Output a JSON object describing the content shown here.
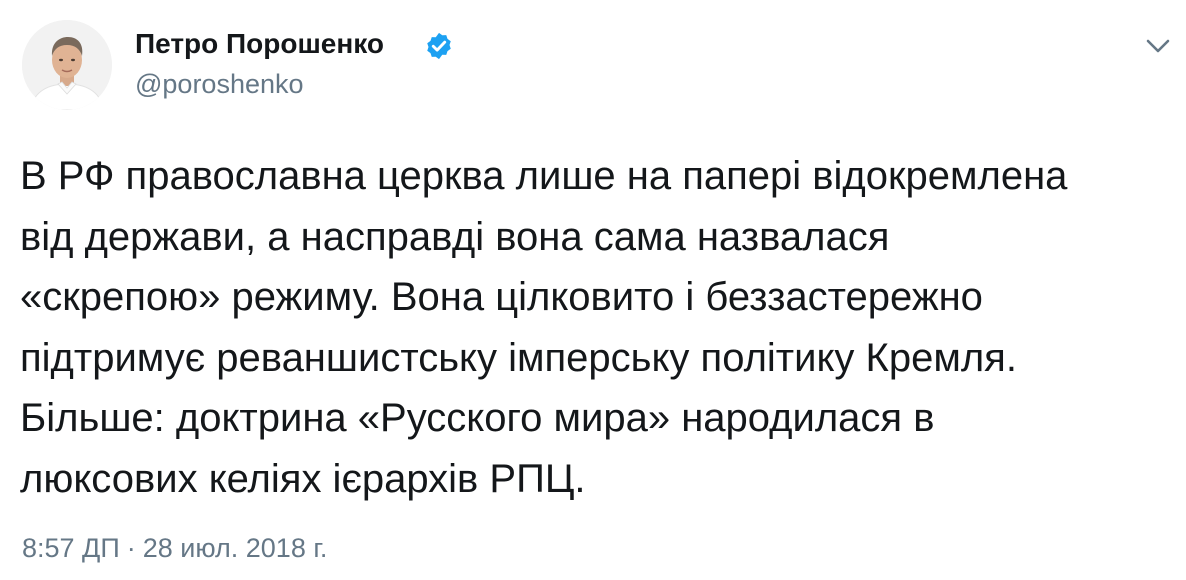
{
  "author": {
    "name": "Петро Порошенко",
    "handle": "@poroshenko",
    "verified": true,
    "avatar": "avatar-photo"
  },
  "menu": {
    "icon": "chevron-down-icon"
  },
  "tweet": {
    "lines": [
      "В РФ православна церква лише на папері відокремлена",
      "від держави, а насправді вона сама назвалася",
      "«скрепою» режиму. Вона цілковито і беззастережно",
      "підтримує реваншистську імперську політику Кремля.",
      "Більше: доктрина «Русского мира» народилася в",
      "люксових келіях ієрархів РПЦ."
    ]
  },
  "meta": {
    "time": "8:57 ДП",
    "separator": "·",
    "date": "28 июл. 2018 г."
  },
  "colors": {
    "text": "#14171a",
    "secondary": "#657786",
    "verified": "#1da1f2"
  }
}
